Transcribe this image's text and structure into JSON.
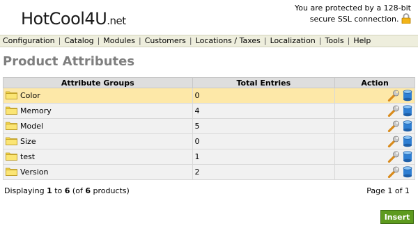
{
  "header": {
    "logo_text": "HotCool4U",
    "logo_suffix": ".net",
    "ssl_text": "You are protected by a 128-bit secure SSL connection."
  },
  "menu": [
    {
      "label": "Configuration"
    },
    {
      "label": "Catalog"
    },
    {
      "label": "Modules"
    },
    {
      "label": "Customers"
    },
    {
      "label": "Locations / Taxes"
    },
    {
      "label": "Localization"
    },
    {
      "label": "Tools"
    },
    {
      "label": "Help"
    }
  ],
  "page": {
    "title": "Product Attributes"
  },
  "table": {
    "columns": [
      "Attribute Groups",
      "Total Entries",
      "Action"
    ],
    "rows": [
      {
        "name": "Color",
        "entries": "0",
        "selected": true
      },
      {
        "name": "Memory",
        "entries": "4"
      },
      {
        "name": "Model",
        "entries": "5"
      },
      {
        "name": "Size",
        "entries": "0"
      },
      {
        "name": "test",
        "entries": "1"
      },
      {
        "name": "Version",
        "entries": "2"
      }
    ]
  },
  "pagination": {
    "displaying_prefix": "Displaying ",
    "from": "1",
    "to_word": " to ",
    "to": "6",
    "of_prefix": " (of ",
    "total": "6",
    "of_suffix": " products)",
    "page_text": "Page 1 of 1"
  },
  "buttons": {
    "insert": "Insert"
  },
  "colors": {
    "menu_bg": "#eeeedd",
    "selected_row": "#fde8a8",
    "insert_button": "#5d9a1e",
    "title": "#7f7f7f"
  },
  "icons": {
    "folder": "folder-icon",
    "edit": "wrench-icon",
    "delete": "database-icon",
    "lock": "lock-icon"
  }
}
